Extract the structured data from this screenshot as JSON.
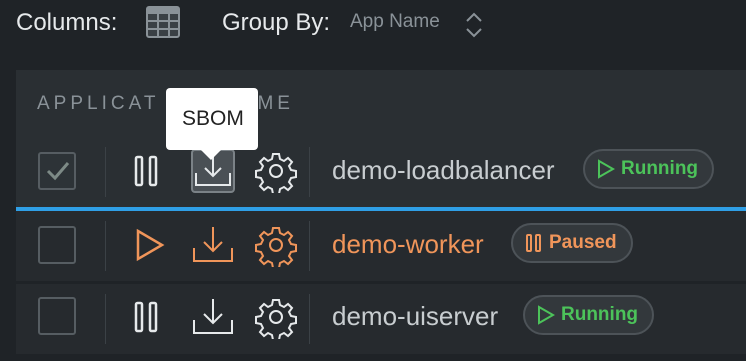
{
  "toolbar": {
    "columns_label": "Columns:",
    "columns_icon": "table-grid-icon",
    "group_by_label": "Group By:",
    "group_by_value": "App Name",
    "sort_icon": "up-down-chevron-icon"
  },
  "table": {
    "header_text": "APPLICAT",
    "header_text_tail": "ME"
  },
  "tooltip": {
    "text": "SBOM"
  },
  "colors": {
    "running": "#4cc35a",
    "paused": "#f0955a",
    "selection_bar": "#2f9fe6"
  },
  "rows": [
    {
      "name": "demo-loadbalancer",
      "status": "Running",
      "checked": true,
      "state_icon": "pause-icon"
    },
    {
      "name": "demo-worker",
      "status": "Paused",
      "checked": false,
      "state_icon": "play-icon"
    },
    {
      "name": "demo-uiserver",
      "status": "Running",
      "checked": false,
      "state_icon": "pause-icon"
    }
  ]
}
